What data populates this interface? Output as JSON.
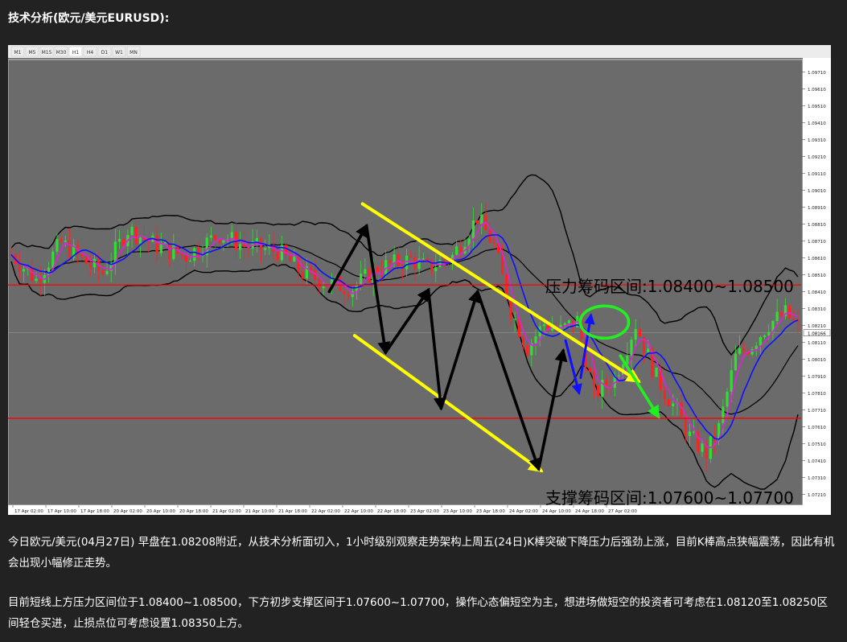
{
  "heading": "技术分析(欧元/美元EURUSD):",
  "chart_data": {
    "type": "candlestick",
    "instrument": "EURUSD",
    "timeframe": "H1",
    "timeframe_tabs": [
      "M1",
      "M5",
      "M15",
      "M30",
      "H1",
      "H4",
      "D1",
      "W1",
      "MN"
    ],
    "ylim": [
      1.0715,
      1.0978
    ],
    "y_ticks": [
      "1.09710",
      "1.09610",
      "1.09510",
      "1.09410",
      "1.09310",
      "1.09210",
      "1.09110",
      "1.09010",
      "1.08910",
      "1.08810",
      "1.08710",
      "1.08610",
      "1.08510",
      "1.08410",
      "1.08310",
      "1.08210",
      "1.08110",
      "1.08010",
      "1.07910",
      "1.07810",
      "1.07710",
      "1.07610",
      "1.07510",
      "1.07410",
      "1.07310",
      "1.07210"
    ],
    "x_ticks": [
      "17 Apr 02:00",
      "17 Apr 10:00",
      "17 Apr 18:00",
      "20 Apr 02:00",
      "20 Apr 10:00",
      "20 Apr 18:00",
      "21 Apr 02:00",
      "21 Apr 10:00",
      "21 Apr 18:00",
      "22 Apr 02:00",
      "22 Apr 10:00",
      "22 Apr 18:00",
      "23 Apr 02:00",
      "23 Apr 10:00",
      "23 Apr 18:00",
      "24 Apr 02:00",
      "24 Apr 10:00",
      "24 Apr 18:00",
      "27 Apr 02:00"
    ],
    "current_price": "1.08166",
    "resistance_line": 1.0845,
    "support_line": 1.0766,
    "annotations": {
      "resistance": "压力筹码区间:1.08400~1.08500",
      "support": "支撑筹码区间:1.07600~1.07700"
    },
    "colors": {
      "background": "#6b6b6b",
      "bull_candle": "#33dd33",
      "bear_candle": "#ff2222",
      "level_line": "#ff0000",
      "channel": "#ffff00",
      "moving_average": "#1010ff",
      "bollinger": "#000000",
      "forecast": "#22ee22"
    }
  },
  "paragraph1": "今日欧元/美元(04月27日) 早盘在1.08208附近，从技术分析面切入，1小时级别观察走势架构上周五(24日)K棒突破下降压力后强劲上涨，目前K棒高点狭幅震荡，因此有机会出现小幅修正走势。",
  "paragraph2": "目前短线上方压力区间位于1.08400~1.08500，下方初步支撑区间于1.07600~1.07700，操作心态偏短空为主，想进场做短空的投资者可考虑在1.08120至1.08250区间轻仓买进，止损点位可考虑设置1.08350上方。"
}
